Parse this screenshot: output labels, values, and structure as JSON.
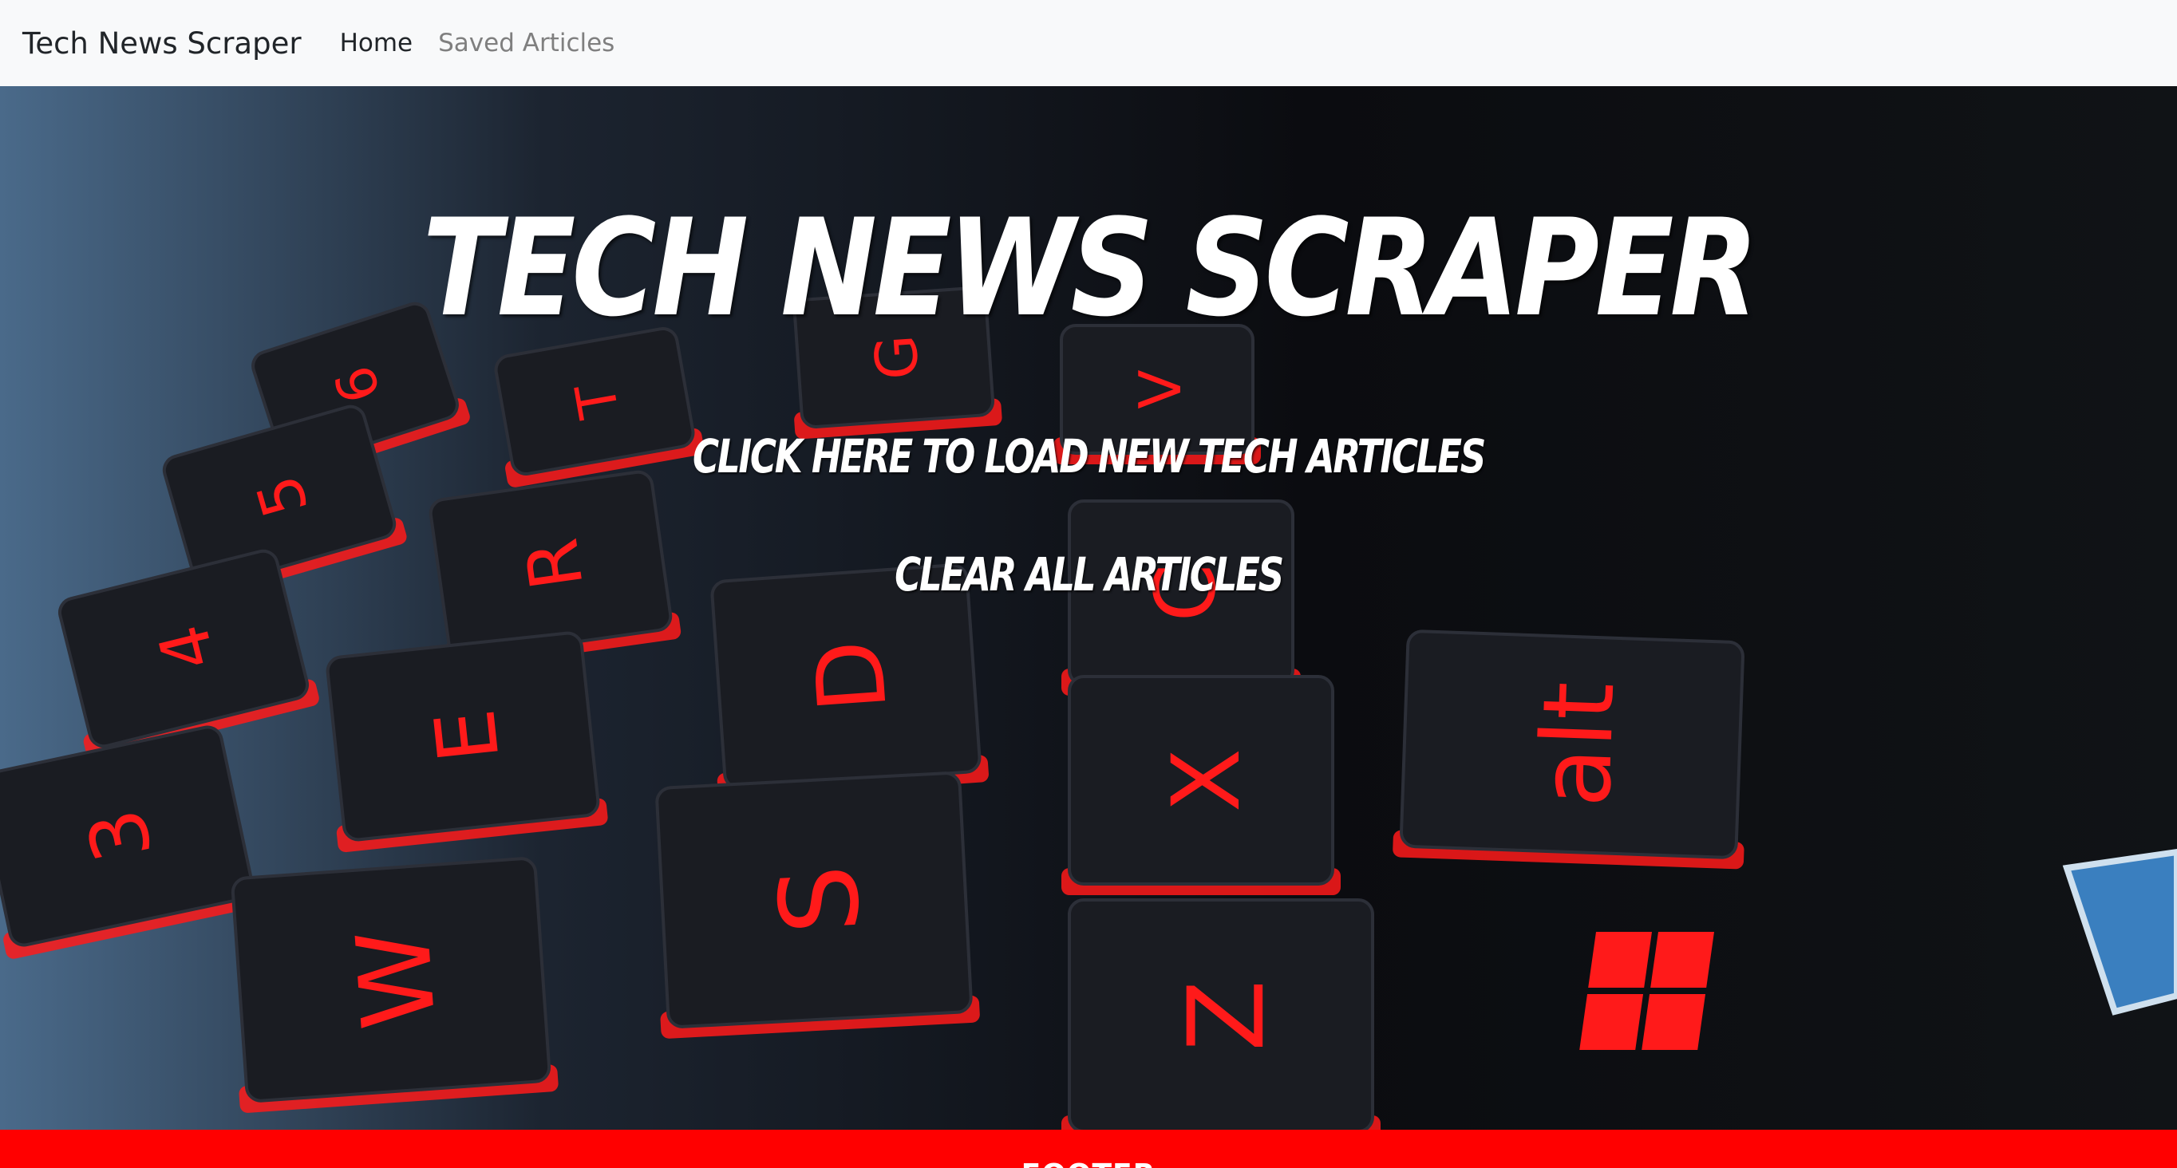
{
  "navbar": {
    "brand": "Tech News Scraper",
    "links": [
      "Home",
      "Saved Articles"
    ]
  },
  "hero": {
    "title": "TECH NEWS SCRAPER",
    "load_button": "CLICK HERE TO LOAD NEW TECH ARTICLES",
    "clear_button": "CLEAR ALL ARTICLES",
    "background_description_icon": "backlit-keyboard-photo",
    "keycaps": [
      "6",
      "5",
      "4",
      "3",
      "T",
      "R",
      "E",
      "W",
      "G",
      "D",
      "S",
      "V",
      "C",
      "X",
      "Z",
      "alt"
    ]
  },
  "footer": {
    "text": "FOOTER"
  },
  "colors": {
    "navbar_bg": "#f8f9fa",
    "footer_bg": "#ff0000",
    "accent_red": "#ff1a1a"
  }
}
